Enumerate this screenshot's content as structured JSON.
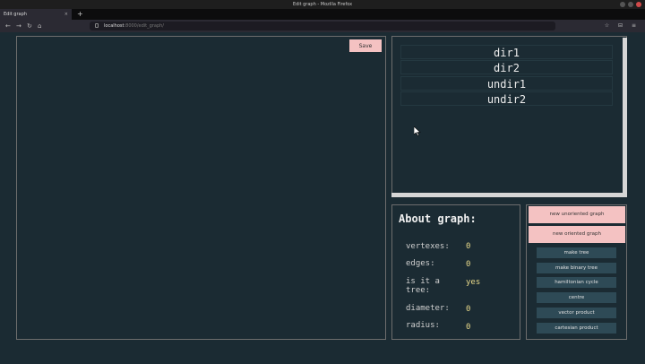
{
  "window": {
    "title": "Edit graph - Mozilla Firefox"
  },
  "tab": {
    "label": "Edit graph",
    "close": "×",
    "new_tab": "+"
  },
  "nav": {
    "back": "←",
    "forward": "→",
    "reload": "↻",
    "home": "⌂"
  },
  "url": {
    "host": "localhost",
    "path": ":8000/edit_graph/"
  },
  "toolbar_icons": "☆ ⊟ ≡",
  "canvas": {
    "save_label": "Save"
  },
  "graph_list": [
    "dir1",
    "dir2",
    "undir1",
    "undir2"
  ],
  "about": {
    "title": "About graph:",
    "props": [
      {
        "label": "vertexes:",
        "value": "0"
      },
      {
        "label": "edges:",
        "value": "0"
      },
      {
        "label": "is it a",
        "label2": "tree:",
        "value": "yes"
      },
      {
        "label": "diameter:",
        "value": "0"
      },
      {
        "label": "radius:",
        "value": "0"
      }
    ]
  },
  "actions": {
    "new_unoriented": "new unoriented graph",
    "new_oriented": "new oriented graph",
    "make_tree": "make tree",
    "make_binary_tree": "make binary tree",
    "hamiltonian_cycle": "hamiltonian cycle",
    "centre": "centre",
    "vector_product": "vector product",
    "cartesian_product": "cartesian product"
  },
  "colors": {
    "background": "#1b2b33",
    "pink": "#f4c2c2",
    "dark_button": "#2e4a56",
    "value": "#e8d98a"
  }
}
